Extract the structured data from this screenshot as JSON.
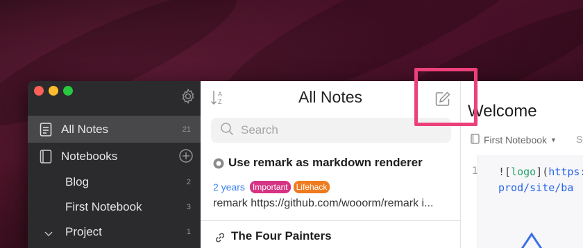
{
  "colors": {
    "accent_highlight": "#ec407a",
    "tag_important": "#d63384",
    "tag_lifehack": "#f07b1e",
    "link_blue": "#3b82f6"
  },
  "sidebar": {
    "all_notes": {
      "label": "All Notes",
      "count": "21",
      "icon": "notes-icon"
    },
    "notebooks": {
      "label": "Notebooks",
      "icon": "book-icon",
      "add_icon": "plus-circle-icon"
    },
    "items": [
      {
        "label": "Blog",
        "count": "2"
      },
      {
        "label": "First Notebook",
        "count": "3"
      },
      {
        "label": "Project",
        "count": "1"
      }
    ],
    "settings_icon": "gear-icon"
  },
  "notelist": {
    "title": "All Notes",
    "sort_icon": "sort-icon",
    "compose_icon": "compose-icon",
    "search": {
      "placeholder": "Search"
    },
    "notes": [
      {
        "title": "Use remark as markdown renderer",
        "age": "2 years",
        "tags": [
          "Important",
          "Lifehack"
        ],
        "excerpt": "remark https://github.com/wooorm/remark i..."
      },
      {
        "title": "The Four Painters"
      }
    ]
  },
  "editor": {
    "title": "Welcome",
    "notebook": "First Notebook",
    "line_number": "1",
    "code": {
      "bang_bracket": "![",
      "link_text": "logo",
      "close_bracket": "](",
      "url_start": "https:",
      "url_cont": "prod/site/ba"
    },
    "extra": "S"
  }
}
